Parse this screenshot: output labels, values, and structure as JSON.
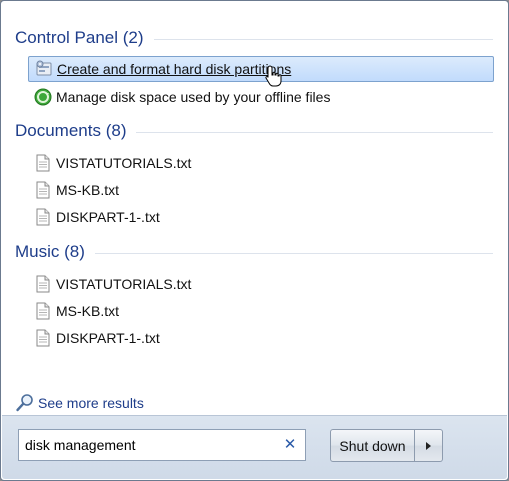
{
  "sections": [
    {
      "title": "Control Panel (2)",
      "items": [
        {
          "label": "Create and format hard disk partitions",
          "icon": "control-panel-disk-icon",
          "selected": true
        },
        {
          "label": "Manage disk space used by your offline files",
          "icon": "green-sync-icon",
          "selected": false
        }
      ]
    },
    {
      "title": "Documents (8)",
      "items": [
        {
          "label": "VISTATUTORIALS.txt",
          "icon": "text-document-icon"
        },
        {
          "label": "MS-KB.txt",
          "icon": "text-document-icon"
        },
        {
          "label": "DISKPART-1-.txt",
          "icon": "text-document-icon"
        }
      ]
    },
    {
      "title": "Music (8)",
      "items": [
        {
          "label": "VISTATUTORIALS.txt",
          "icon": "text-document-icon"
        },
        {
          "label": "MS-KB.txt",
          "icon": "text-document-icon"
        },
        {
          "label": "DISKPART-1-.txt",
          "icon": "text-document-icon"
        }
      ]
    }
  ],
  "see_more": {
    "label": "See more results",
    "icon": "magnifier-icon"
  },
  "search": {
    "value": "disk management",
    "clear_icon": "clear-x-icon"
  },
  "shutdown": {
    "label": "Shut down",
    "arrow_icon": "triangle-right-icon"
  },
  "colors": {
    "section_title": "#1e3d8a",
    "selection_fill": "#c1dbfc",
    "selection_border": "#7da2ce",
    "bottom_bar": "#d5dfeb"
  }
}
